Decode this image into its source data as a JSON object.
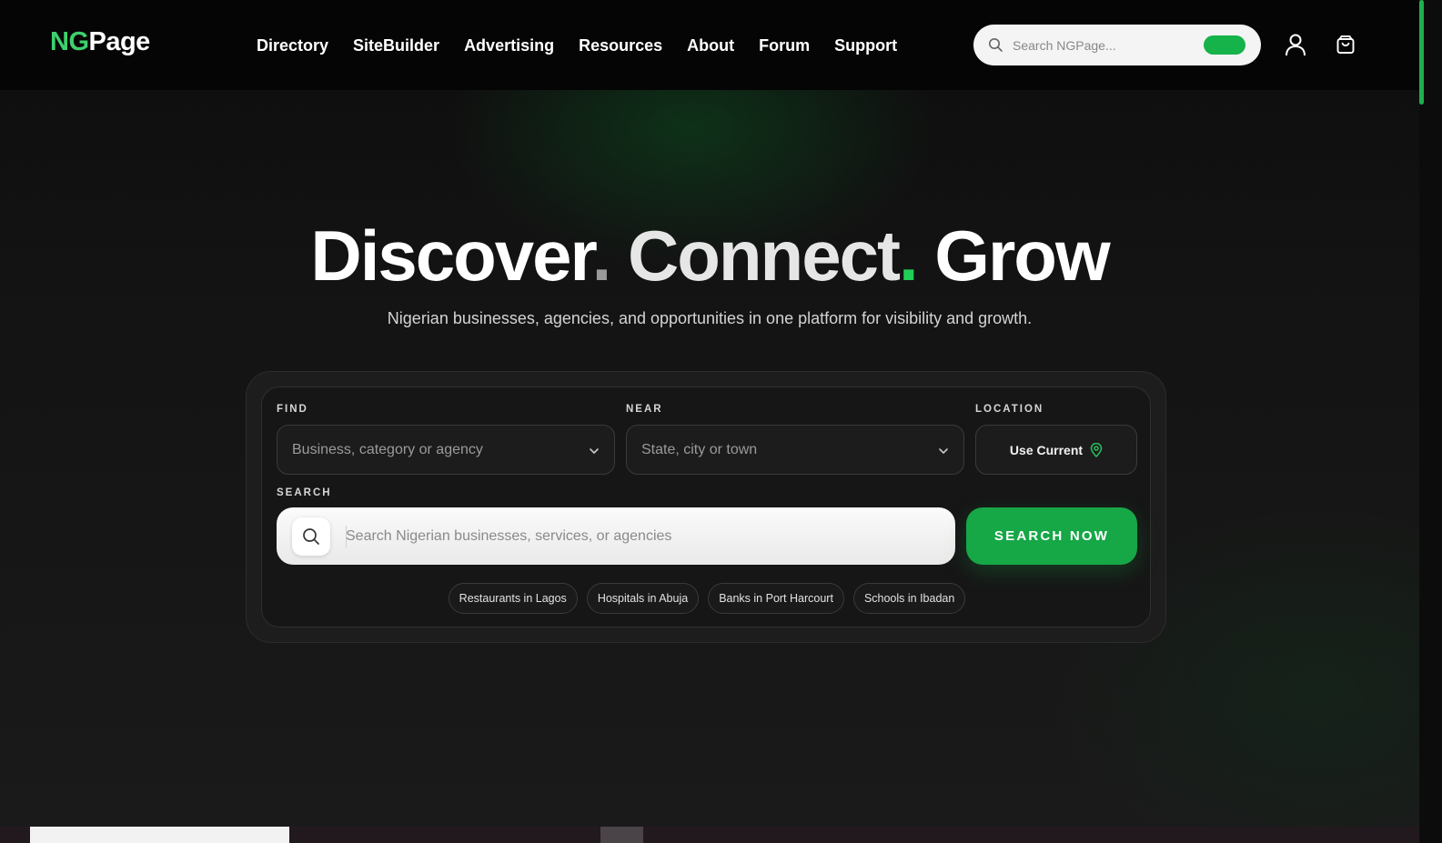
{
  "header": {
    "logo_ng": "NG",
    "logo_page": "Page",
    "nav": [
      "Directory",
      "SiteBuilder",
      "Advertising",
      "Resources",
      "About",
      "Forum",
      "Support"
    ],
    "search_placeholder": "Search NGPage...",
    "icons": [
      "search-icon",
      "user-icon",
      "shopping-bag-icon"
    ]
  },
  "hero": {
    "word1": "Discover",
    "word2": "Connect",
    "word3": "Grow",
    "dot": ".",
    "subtitle": "Nigerian businesses, agencies, and opportunities in one platform for visibility and growth."
  },
  "search_panel": {
    "find_label": "FIND",
    "find_value": "Business, category or agency",
    "near_label": "NEAR",
    "near_value": "State, city or town",
    "location_label": "LOCATION",
    "use_current": "Use Current",
    "search_label": "SEARCH",
    "search_placeholder": "Search Nigerian businesses, services, or agencies",
    "search_button": "SEARCH NOW",
    "suggestions": [
      "Restaurants in Lagos",
      "Hospitals in Abuja",
      "Banks in Port Harcourt",
      "Schools in Ibadan"
    ]
  },
  "colors": {
    "accent": "#16a747",
    "logo_green": "#3ecf6e",
    "background": "#151515"
  }
}
